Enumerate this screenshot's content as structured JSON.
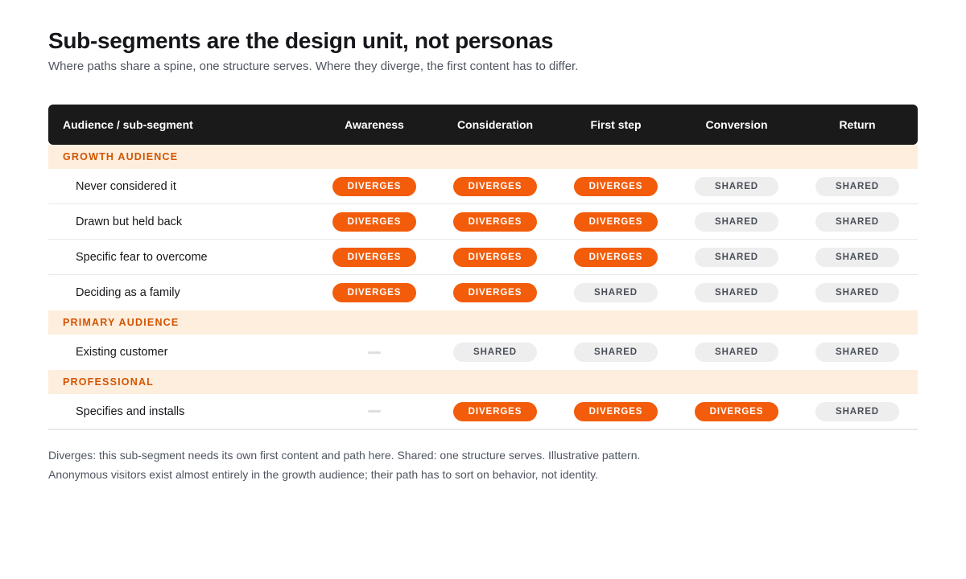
{
  "title": "Sub-segments are the design unit, not personas",
  "subtitle": "Where paths share a spine, one structure serves. Where they diverge, the first content has to differ.",
  "table": {
    "header": {
      "label": "Audience / sub-segment",
      "stages": [
        "Awareness",
        "Consideration",
        "First step",
        "Conversion",
        "Return"
      ]
    },
    "status_labels": {
      "diverges": "DIVERGES",
      "shared": "SHARED"
    },
    "groups": [
      {
        "name": "GROWTH AUDIENCE",
        "rows": [
          {
            "label": "Never considered it",
            "cells": [
              "diverges",
              "diverges",
              "diverges",
              "shared",
              "shared"
            ]
          },
          {
            "label": "Drawn but held back",
            "cells": [
              "diverges",
              "diverges",
              "diverges",
              "shared",
              "shared"
            ]
          },
          {
            "label": "Specific fear to overcome",
            "cells": [
              "diverges",
              "diverges",
              "diverges",
              "shared",
              "shared"
            ]
          },
          {
            "label": "Deciding as a family",
            "cells": [
              "diverges",
              "diverges",
              "shared",
              "shared",
              "shared"
            ]
          }
        ]
      },
      {
        "name": "PRIMARY AUDIENCE",
        "rows": [
          {
            "label": "Existing customer",
            "cells": [
              "none",
              "shared",
              "shared",
              "shared",
              "shared"
            ]
          }
        ]
      },
      {
        "name": "PROFESSIONAL",
        "rows": [
          {
            "label": "Specifies and installs",
            "cells": [
              "none",
              "diverges",
              "diverges",
              "diverges",
              "shared"
            ]
          }
        ]
      }
    ]
  },
  "notes": [
    "Diverges: this sub-segment needs its own first content and path here. Shared: one structure serves. Illustrative pattern.",
    "Anonymous visitors exist almost entirely in the growth audience; their path has to sort on behavior, not identity."
  ],
  "colors": {
    "header_bg": "#1a1a1a",
    "group_bg": "#fdeede",
    "group_text": "#d35400",
    "diverges": "#f25c0a",
    "shared_bg": "#eeeeef"
  }
}
